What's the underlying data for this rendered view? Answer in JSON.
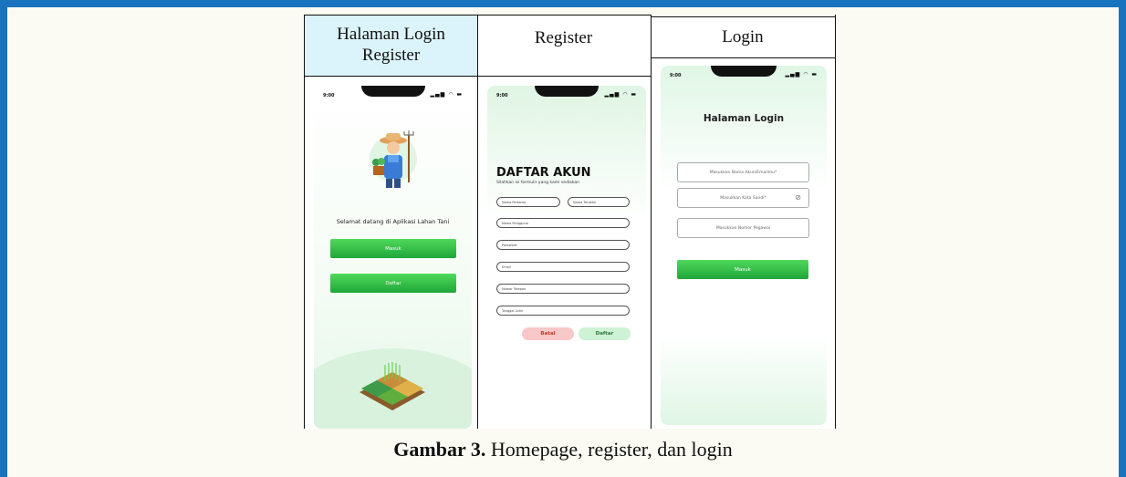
{
  "figure": {
    "columns": [
      {
        "header_line1": "Halaman Login",
        "header_line2": "Register",
        "phone": {
          "time": "9:00",
          "status": "▂▄▆ ◠ ▬",
          "welcome": "Selamat datang di Aplikasi Lahan Tani",
          "masuk": "Masuk",
          "daftar": "Daftar"
        }
      },
      {
        "header": "Register",
        "phone": {
          "time": "9:00",
          "status": "▂▄▆ ◠ ▬",
          "title": "DAFTAR AKUN",
          "subtitle": "Silahkan isi formulir yang kami sediakan",
          "nama_pertama": "Nama Pertama",
          "nama_terakhir": "Nama Terakhir",
          "nama_pengguna": "Nama Pengguna",
          "password": "Password",
          "email": "Email",
          "nomor_telepon": "Nomor Telepon",
          "tanggal_lahir": "Tanggal Lahir",
          "batal": "Batal",
          "daftar": "Daftar"
        }
      },
      {
        "header": "Login",
        "phone": {
          "time": "9:00",
          "status": "▂▄▆ ◠ ▬",
          "title": "Halaman Login",
          "nama_akun": "Masukkan Nama Akun/Emailmu*",
          "kata_sandi": "Masukkan Kata Sandi*",
          "nomor_pegawai": "Masukkan Nomor Pegawai",
          "masuk": "Masuk"
        }
      }
    ]
  },
  "caption": {
    "label": "Gambar 3.",
    "text": " Homepage, register, dan login"
  },
  "colors": {
    "frame": "#1a73be",
    "page_bg": "#fbfbf3",
    "header_highlight": "#dbf3fb",
    "button_green": "#1fa63a",
    "cancel_pink": "#f8c7c7",
    "confirm_mint": "#cdf2d4"
  }
}
